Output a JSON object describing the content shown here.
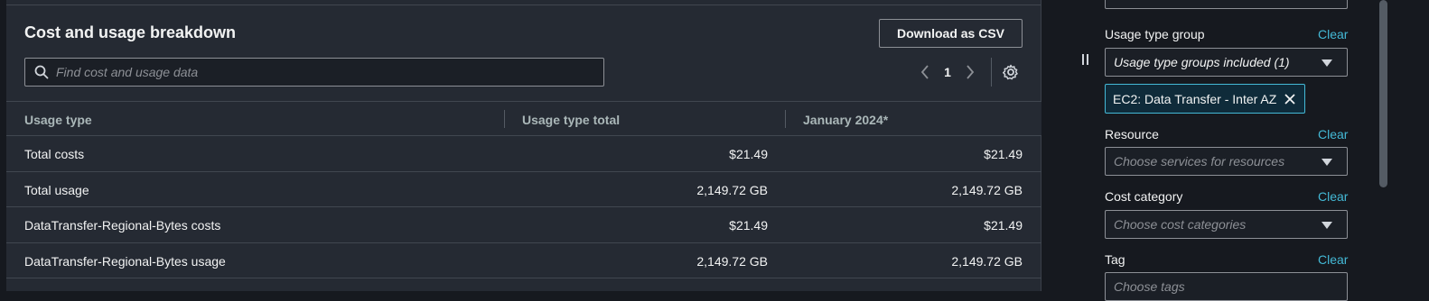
{
  "panel": {
    "title": "Cost and usage breakdown",
    "download_label": "Download as CSV",
    "search_placeholder": "Find cost and usage data",
    "page_number": "1"
  },
  "table": {
    "headers": [
      "Usage type",
      "Usage type total",
      "January 2024*"
    ],
    "rows": [
      {
        "type": "Total costs",
        "total": "$21.49",
        "jan": "$21.49"
      },
      {
        "type": "Total usage",
        "total": "2,149.72 GB",
        "jan": "2,149.72 GB"
      },
      {
        "type": "DataTransfer-Regional-Bytes costs",
        "total": "$21.49",
        "jan": "$21.49"
      },
      {
        "type": "DataTransfer-Regional-Bytes usage",
        "total": "2,149.72 GB",
        "jan": "2,149.72 GB"
      }
    ]
  },
  "filters": {
    "clear_label": "Clear",
    "usage_type_group": {
      "label": "Usage type group",
      "value": "Usage type groups included (1)",
      "token": "EC2: Data Transfer - Inter AZ"
    },
    "resource": {
      "label": "Resource",
      "placeholder": "Choose services for resources"
    },
    "cost_category": {
      "label": "Cost category",
      "placeholder": "Choose cost categories"
    },
    "tag": {
      "label": "Tag",
      "placeholder": "Choose tags"
    }
  },
  "colors": {
    "accent": "#44b9d6",
    "panel_bg": "#252a33",
    "page_bg": "#16191f",
    "border": "#8d9096"
  },
  "icons": [
    "search-icon",
    "chevron-left-icon",
    "chevron-right-icon",
    "gear-icon",
    "drag-handle-icon",
    "close-icon",
    "caret-down-icon"
  ]
}
